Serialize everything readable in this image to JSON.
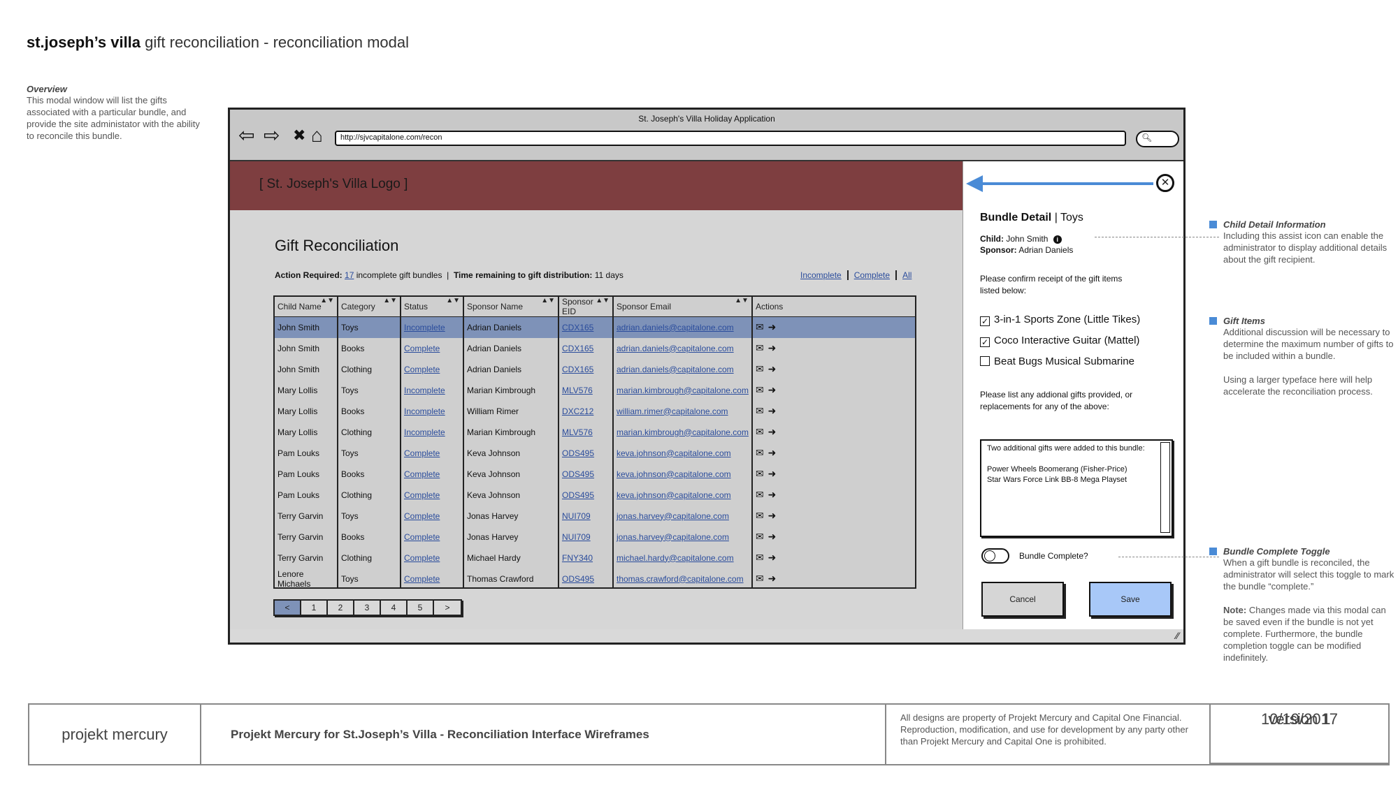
{
  "page": {
    "title_bold": "st.joseph’s villa",
    "title_rest": "gift reconciliation - reconciliation modal"
  },
  "overview": {
    "heading": "Overview",
    "text": "This modal window will list the gifts associated with a particular bundle, and provide the site administator with the ability to reconcile this bundle."
  },
  "browser": {
    "window_title": "St. Joseph's Villa Holiday Application",
    "url": "http://sjvcapitalone.com/recon",
    "nav": {
      "back": "⇦",
      "forward": "⇨",
      "stop": "✖",
      "home": "⌂"
    }
  },
  "app": {
    "logo": "[ St. Joseph's Villa Logo ]",
    "title": "Gift Reconciliation",
    "action_label": "Action Required:",
    "action_count": "17",
    "action_text": "incomplete gift bundles",
    "separator": "|",
    "time_label": "Time remaining to gift distribution:",
    "time_value": "11 days",
    "filters": [
      "Incomplete",
      "Complete",
      "All"
    ]
  },
  "table": {
    "columns": [
      "Child Name",
      "Category",
      "Status",
      "Sponsor Name",
      "Sponsor EID",
      "Sponsor Email",
      "Actions"
    ],
    "rows": [
      [
        "John Smith",
        "Toys",
        "Incomplete",
        "Adrian Daniels",
        "CDX165",
        "adrian.daniels@capitalone.com"
      ],
      [
        "John Smith",
        "Books",
        "Complete",
        "Adrian Daniels",
        "CDX165",
        "adrian.daniels@capitalone.com"
      ],
      [
        "John Smith",
        "Clothing",
        "Complete",
        "Adrian Daniels",
        "CDX165",
        "adrian.daniels@capitalone.com"
      ],
      [
        "Mary Lollis",
        "Toys",
        "Incomplete",
        "Marian Kimbrough",
        "MLV576",
        "marian.kimbrough@capitalone.com"
      ],
      [
        "Mary Lollis",
        "Books",
        "Incomplete",
        "William Rimer",
        "DXC212",
        "william.rimer@capitalone.com"
      ],
      [
        "Mary Lollis",
        "Clothing",
        "Incomplete",
        "Marian Kimbrough",
        "MLV576",
        "marian.kimbrough@capitalone.com"
      ],
      [
        "Pam Louks",
        "Toys",
        "Complete",
        "Keva Johnson",
        "ODS495",
        "keva.johnson@capitalone.com"
      ],
      [
        "Pam Louks",
        "Books",
        "Complete",
        "Keva Johnson",
        "ODS495",
        "keva.johnson@capitalone.com"
      ],
      [
        "Pam Louks",
        "Clothing",
        "Complete",
        "Keva Johnson",
        "ODS495",
        "keva.johnson@capitalone.com"
      ],
      [
        "Terry Garvin",
        "Toys",
        "Complete",
        "Jonas Harvey",
        "NUI709",
        "jonas.harvey@capitalone.com"
      ],
      [
        "Terry Garvin",
        "Books",
        "Complete",
        "Jonas Harvey",
        "NUI709",
        "jonas.harvey@capitalone.com"
      ],
      [
        "Terry Garvin",
        "Clothing",
        "Complete",
        "Michael Hardy",
        "FNY340",
        "michael.hardy@capitalone.com"
      ],
      [
        "Lenore Michaels",
        "Toys",
        "Complete",
        "Thomas Crawford",
        "ODS495",
        "thomas.crawford@capitalone.com"
      ]
    ],
    "selected_row": 0
  },
  "pager": [
    "<",
    "1",
    "2",
    "3",
    "4",
    "5",
    ">"
  ],
  "modal": {
    "title_bold": "Bundle Detail",
    "title_rest": "| Toys",
    "child_label": "Child:",
    "child_value": "John Smith",
    "sponsor_label": "Sponsor:",
    "sponsor_value": "Adrian Daniels",
    "confirm_text": "Please confirm receipt of the gift items listed below:",
    "items": [
      {
        "label": "3-in-1 Sports Zone (Little Tikes)",
        "checked": true
      },
      {
        "label": "Coco Interactive Guitar (Mattel)",
        "checked": true
      },
      {
        "label": "Beat Bugs Musical Submarine",
        "checked": false
      }
    ],
    "additional_prompt": "Please list any addional gifts provided, or replacements for any of the above:",
    "notes_line1": "Two additional gifts were added to this bundle:",
    "notes_line2": "Power Wheels Boomerang (Fisher-Price)",
    "notes_line3": "Star Wars Force Link BB-8 Mega Playset",
    "toggle_label": "Bundle Complete?",
    "toggle_on": false,
    "cancel_label": "Cancel",
    "save_label": "Save"
  },
  "annotations": {
    "child_detail_heading": "Child Detail Information",
    "child_detail_text": "Including this assist icon can enable the administrator to display additional details about the gift recipient.",
    "gift_items_heading": "Gift Items",
    "gift_items_text1": "Additional discussion will be necessary to determine the maximum number of gifts to be included within a bundle.",
    "gift_items_text2": "Using a larger typeface here will help accelerate the reconciliation process.",
    "toggle_heading": "Bundle Complete Toggle",
    "toggle_text": "When a gift bundle is reconciled, the administrator will select this toggle to mark the bundle “complete.”",
    "note_label": "Note:",
    "note_text": "Changes made via this modal can be saved even if the bundle is not yet complete. Furthermore, the bundle completion toggle can be modified indefinitely."
  },
  "footer": {
    "brand": "projekt mercury",
    "project": "Projekt Mercury for St.Joseph’s Villa - Reconciliation Interface Wireframes",
    "legal": "All designs are property of Projekt Mercury and Capital One Financial. Reproduction, modification, and use for development by any party other than Projekt Mercury and Capital One is prohibited.",
    "version": "version 1",
    "date": "10/19/2017"
  },
  "colors": {
    "banner": "#7e3e40",
    "selected_row": "#7e92b8",
    "accent": "#4a8bd6",
    "save_button": "#a8c8f8",
    "link": "#2a4c9c"
  }
}
